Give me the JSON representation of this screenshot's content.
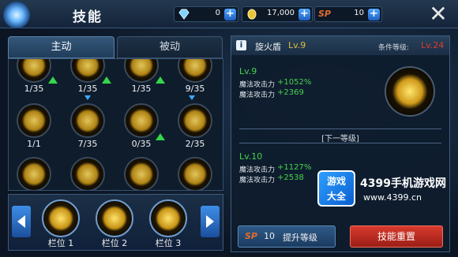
{
  "header": {
    "title": "技能",
    "resources": [
      {
        "icon": "diamond-icon",
        "value": "0"
      },
      {
        "icon": "gold-coin-icon",
        "value": "17,000"
      },
      {
        "icon": "sp-icon",
        "label": "SP",
        "value": "10"
      }
    ],
    "plus": "+",
    "close": "✕"
  },
  "tabs": {
    "active": "主动",
    "passive": "被动"
  },
  "skills": {
    "row1": [
      "1/35",
      "1/35",
      "1/35",
      "9/35"
    ],
    "row2": [
      "1/1",
      "7/35",
      "0/35",
      "2/35"
    ]
  },
  "slots": [
    "栏位 1",
    "栏位 2",
    "栏位 3"
  ],
  "detail": {
    "info": "i",
    "name": "旋火盾",
    "level": "Lv.9",
    "req_label": "条件等级:",
    "req_value": "Lv.24",
    "current": {
      "level": "Lv.9",
      "stats": [
        {
          "label": "魔法攻击力",
          "value": "+1052%"
        },
        {
          "label": "魔法攻击力",
          "value": "+2369"
        }
      ]
    },
    "next_label": "[下一等级]",
    "next": {
      "level": "Lv.10",
      "stats": [
        {
          "label": "魔法攻击力",
          "value": "+1127%"
        },
        {
          "label": "魔法攻击力",
          "value": "+2538"
        }
      ]
    },
    "upgrade": {
      "sp": "SP",
      "cost": "10",
      "label": "提升等级"
    },
    "reset": "技能重置"
  },
  "watermark": {
    "box_line1": "游戏",
    "box_line2": "大全",
    "site": "4399手机游戏网",
    "url": "www.4399.cn"
  },
  "colors": {
    "accent_blue": "#3e8ee8",
    "level_green": "#46d34a",
    "req_red": "#e23a2a",
    "reset_red": "#d83a2c"
  }
}
